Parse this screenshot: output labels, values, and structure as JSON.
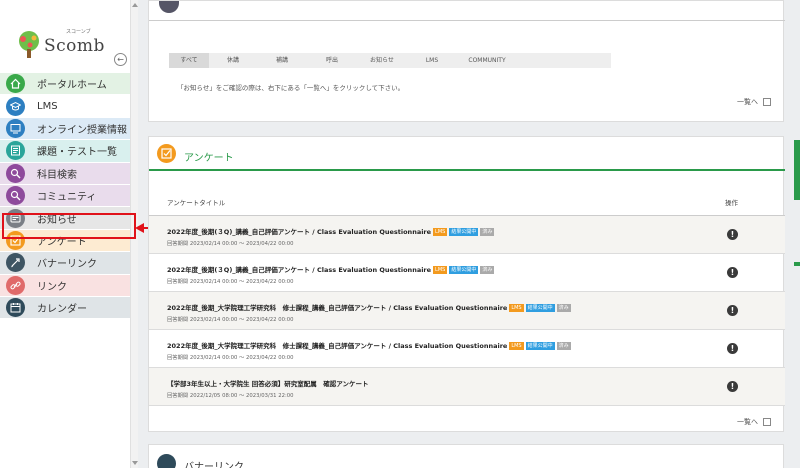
{
  "logo": {
    "text": "Scomb",
    "small": "スコーンブ"
  },
  "sidebar": {
    "items": [
      {
        "label": "ポータルホーム",
        "icon": "home-icon",
        "color": "#3aa94a",
        "bg": "#e3f2e4"
      },
      {
        "label": "LMS",
        "icon": "graduation-cap-icon",
        "color": "#2d7fc1",
        "bg": "#ffffff"
      },
      {
        "label": "オンライン授業情報",
        "icon": "online-class-icon",
        "color": "#2d7fc1",
        "bg": "#dceaf6"
      },
      {
        "label": "課題・テスト一覧",
        "icon": "task-list-icon",
        "color": "#2aa59a",
        "bg": "#d9f0ee"
      },
      {
        "label": "科目検索",
        "icon": "search-icon",
        "color": "#8e4a9c",
        "bg": "#e9dcec"
      },
      {
        "label": "コミュニティ",
        "icon": "community-icon",
        "color": "#8e4a9c",
        "bg": "#e9dcec"
      },
      {
        "label": "お知らせ",
        "icon": "notice-icon",
        "color": "#7a7f86",
        "bg": "#e6e6e6"
      },
      {
        "label": "アンケート",
        "icon": "survey-icon",
        "color": "#f39a1e",
        "bg": "#fdebd2"
      },
      {
        "label": "バナーリンク",
        "icon": "banner-link-icon",
        "color": "#3e5563",
        "bg": "#dfe4e7"
      },
      {
        "label": "リンク",
        "icon": "link-icon",
        "color": "#e06a6a",
        "bg": "#f9e1e1"
      },
      {
        "label": "カレンダー",
        "icon": "calendar-icon",
        "color": "#2e4a5a",
        "bg": "#dfe4e7"
      }
    ]
  },
  "notices": {
    "tabs": [
      "すべて",
      "休講",
      "補講",
      "呼出",
      "お知らせ",
      "LMS",
      "COMMUNITY"
    ],
    "message": "「お知らせ」をご確認の際は、右下にある「一覧へ」をクリックして下さい。",
    "more": "一覧へ"
  },
  "survey": {
    "title": "アンケート",
    "col_title": "アンケートタイトル",
    "col_op": "操作",
    "rows": [
      {
        "title": "2022年度_後期(３Q)_講義_自己評価アンケート / Class Evaluation Questionnaire",
        "badges": [
          "LMS",
          "結果公開中",
          "済み"
        ],
        "period": "回答期間 2023/02/14 00:00 ～ 2023/04/22 00:00"
      },
      {
        "title": "2022年度_後期(３Q)_講義_自己評価アンケート / Class Evaluation Questionnaire",
        "badges": [
          "LMS",
          "結果公開中",
          "済み"
        ],
        "period": "回答期間 2023/02/14 00:00 ～ 2023/04/22 00:00"
      },
      {
        "title": "2022年度_後期_大学院理工学研究科　修士課程_講義_自己評価アンケート / Class Evaluation Questionnaire",
        "badges": [
          "LMS",
          "結果公開中",
          "済み"
        ],
        "period": "回答期間 2023/02/14 00:00 ～ 2023/04/22 00:00"
      },
      {
        "title": "2022年度_後期_大学院理工学研究科　修士課程_講義_自己評価アンケート / Class Evaluation Questionnaire",
        "badges": [
          "LMS",
          "結果公開中",
          "済み"
        ],
        "period": "回答期間 2023/02/14 00:00 ～ 2023/04/22 00:00"
      },
      {
        "title": "【学部3年生以上・大学院生 回答必須】研究室配属　確認アンケート",
        "badges": [],
        "period": "回答期間 2022/12/05 08:00 ～ 2023/03/31 22:00"
      }
    ],
    "more": "一覧へ"
  },
  "banner": {
    "title": "バナーリンク"
  },
  "colors": {
    "accent_green": "#2a9a4a",
    "highlight_red": "#e0121a",
    "lms": "#f39a1e",
    "published": "#2f9ee0",
    "done": "#aaaaaa"
  }
}
